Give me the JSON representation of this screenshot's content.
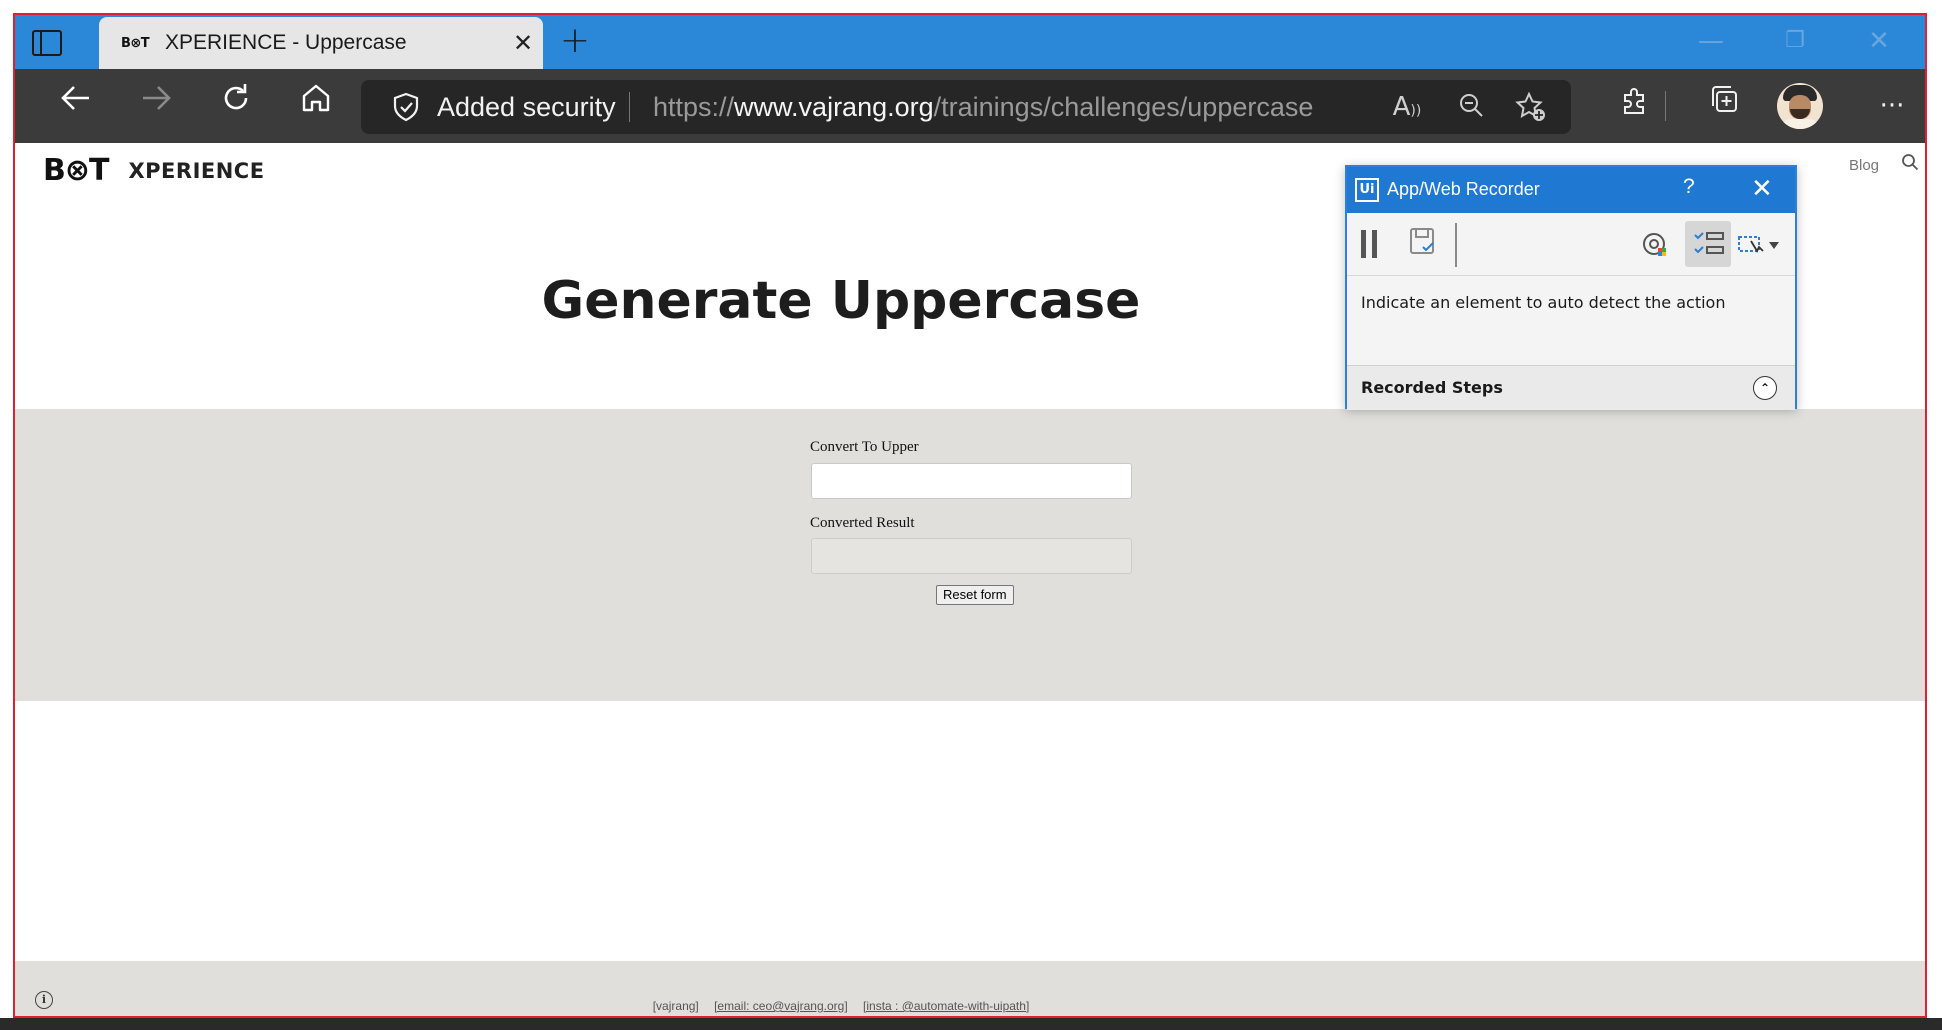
{
  "browser": {
    "tab_title": "XPERIENCE - Uppercase",
    "tab_favicon_text": "B⊗T",
    "security_label": "Added security",
    "url_prefix": "https://",
    "url_domain": "www.vajrang.org",
    "url_path": "/trainings/challenges/uppercase",
    "icons": [
      "tab-actions-icon",
      "close-icon",
      "new-tab-icon",
      "back-icon",
      "forward-icon",
      "refresh-icon",
      "home-icon",
      "shield-icon",
      "read-aloud-icon",
      "zoom-out-icon",
      "add-favorite-icon",
      "extensions-icon",
      "collections-icon",
      "profile-avatar",
      "more-icon"
    ]
  },
  "site": {
    "logo": "B⊗T",
    "brand_name": "XPERIENCE",
    "nav": {
      "blog": "Blog"
    },
    "headline": "Generate Uppercase",
    "form": {
      "input_label": "Convert To Upper",
      "input_value": "",
      "result_label": "Converted Result",
      "result_value": "",
      "reset_label": "Reset form"
    },
    "footer": {
      "name": "[vajrang]",
      "email": "[email: ceo@vajrang.org]",
      "insta": "[insta : @automate-with-uipath]"
    }
  },
  "recorder": {
    "title": "App/Web Recorder",
    "logo_text": "Ui",
    "help": "?",
    "message": "Indicate an element to auto detect the action",
    "steps_label": "Recorded Steps"
  },
  "colors": {
    "tabstrip": "#2b88d8",
    "toolbar": "#3b3b3b",
    "form_band": "#e1dfdc",
    "recorder_title": "#1f78d1",
    "frame_border": "#e02030"
  }
}
